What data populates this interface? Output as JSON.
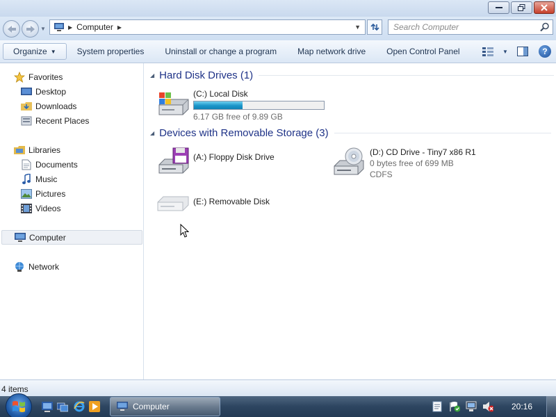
{
  "window": {
    "minimize_icon": "minimize-icon",
    "maximize_icon": "restore-icon",
    "close_icon": "close-icon"
  },
  "address_bar": {
    "location_icon": "computer-icon",
    "breadcrumb": "Computer",
    "search_placeholder": "Search Computer"
  },
  "toolbar": {
    "organize": "Organize",
    "items": [
      "System properties",
      "Uninstall or change a program",
      "Map network drive",
      "Open Control Panel"
    ]
  },
  "navigation": {
    "favorites": {
      "label": "Favorites",
      "icon": "star-icon"
    },
    "favorites_items": [
      {
        "label": "Desktop",
        "icon": "desktop-icon"
      },
      {
        "label": "Downloads",
        "icon": "downloads-folder-icon"
      },
      {
        "label": "Recent Places",
        "icon": "recent-places-icon"
      }
    ],
    "libraries": {
      "label": "Libraries",
      "icon": "libraries-icon"
    },
    "libraries_items": [
      {
        "label": "Documents",
        "icon": "documents-icon"
      },
      {
        "label": "Music",
        "icon": "music-note-icon"
      },
      {
        "label": "Pictures",
        "icon": "pictures-icon"
      },
      {
        "label": "Videos",
        "icon": "film-icon"
      }
    ],
    "computer": {
      "label": "Computer",
      "icon": "computer-icon",
      "selected": true
    },
    "network": {
      "label": "Network",
      "icon": "network-icon"
    }
  },
  "groups": {
    "hard_disks": "Hard Disk Drives (1)",
    "removable": "Devices with Removable Storage (3)"
  },
  "drives": {
    "c": {
      "name": "(C:) Local Disk",
      "free_text": "6.17 GB free of 9.89 GB",
      "used_fraction": 0.376,
      "icon": "windows-hard-disk-icon"
    },
    "a": {
      "name": "(A:) Floppy Disk Drive",
      "icon": "floppy-drive-icon"
    },
    "d": {
      "name": "(D:) CD Drive - Tiny7 x86 R1",
      "free_text": "0 bytes free of 699 MB",
      "filesystem": "CDFS",
      "icon": "cd-drive-icon"
    },
    "e": {
      "name": "(E:) Removable Disk",
      "icon": "removable-disk-icon"
    }
  },
  "status": {
    "items": "4 items"
  },
  "taskbar": {
    "active_window": "Computer",
    "clock": "20:16"
  },
  "colors": {
    "group_title": "#1e3287",
    "progress_fill": "#1a95c9",
    "taskbar": "#2d4560"
  }
}
